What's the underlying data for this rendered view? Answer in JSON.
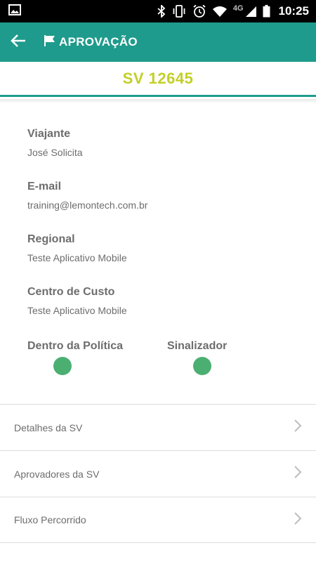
{
  "status_bar": {
    "network": "4G",
    "time": "10:25"
  },
  "app_bar": {
    "title": "APROVAÇÃO"
  },
  "sv": {
    "number": "SV 12645"
  },
  "details": [
    {
      "label": "Viajante",
      "value": "José Solicita"
    },
    {
      "label": "E-mail",
      "value": "training@lemontech.com.br"
    },
    {
      "label": "Regional",
      "value": "Teste Aplicativo Mobile"
    },
    {
      "label": "Centro de Custo",
      "value": "Teste Aplicativo Mobile"
    }
  ],
  "status_indicators": [
    {
      "label": "Dentro da Política",
      "color": "#4caf72"
    },
    {
      "label": "Sinalizador",
      "color": "#4caf72"
    }
  ],
  "menu": [
    {
      "label": "Detalhes da SV",
      "icon": "chevron-right-icon"
    },
    {
      "label": "Aprovadores da SV",
      "icon": "chevron-right-icon"
    },
    {
      "label": "Fluxo Percorrido",
      "icon": "chevron-right-icon"
    }
  ],
  "colors": {
    "primary": "#1e9b8c",
    "sv_number": "#c3cf28",
    "text": "#6d6d6d",
    "indicator_ok": "#4caf72"
  }
}
